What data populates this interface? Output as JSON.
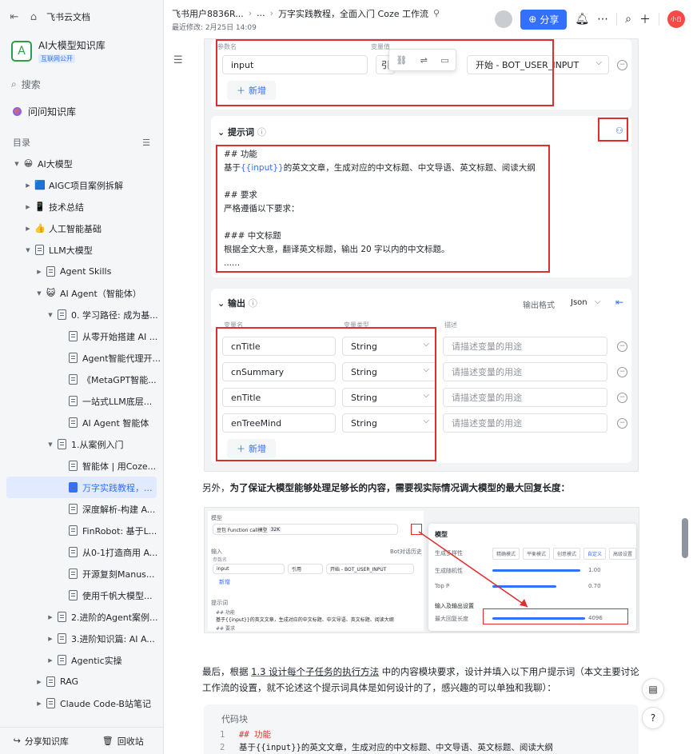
{
  "sidebar": {
    "top_title": "飞书云文档",
    "kb_name": "AI大模型知识库",
    "kb_badge": "互联网公开",
    "search": "搜索",
    "ask": "问问知识库",
    "toc": "目录",
    "tree": [
      {
        "label": "AI大模型",
        "indent": 0,
        "arrow": "▼",
        "icon": "emoji",
        "emoji": "😀"
      },
      {
        "label": "AIGC项目案例拆解",
        "indent": 1,
        "arrow": "▶",
        "icon": "emoji",
        "emoji": "🟦"
      },
      {
        "label": "技术总结",
        "indent": 1,
        "arrow": "▶",
        "icon": "emoji",
        "emoji": "📱"
      },
      {
        "label": "人工智能基础",
        "indent": 1,
        "arrow": "▶",
        "icon": "emoji",
        "emoji": "👍"
      },
      {
        "label": "LLM大模型",
        "indent": 1,
        "arrow": "▼",
        "icon": "doc"
      },
      {
        "label": "Agent Skills",
        "indent": 2,
        "arrow": "▶",
        "icon": "doc"
      },
      {
        "label": "AI Agent（智能体）",
        "indent": 2,
        "arrow": "▼",
        "icon": "emoji",
        "emoji": "😺"
      },
      {
        "label": "0. 学习路径: 成为基...",
        "indent": 3,
        "arrow": "▼",
        "icon": "doc"
      },
      {
        "label": "从零开始搭建 AI ...",
        "indent": 4,
        "arrow": "",
        "icon": "doc"
      },
      {
        "label": "Agent智能代理开...",
        "indent": 4,
        "arrow": "",
        "icon": "doc"
      },
      {
        "label": "《MetaGPT智能...",
        "indent": 4,
        "arrow": "",
        "icon": "doc"
      },
      {
        "label": "一站式LLM底层...",
        "indent": 4,
        "arrow": "",
        "icon": "doc"
      },
      {
        "label": "AI Agent 智能体",
        "indent": 4,
        "arrow": "",
        "icon": "doc"
      },
      {
        "label": "1.从案例入门",
        "indent": 3,
        "arrow": "▼",
        "icon": "doc"
      },
      {
        "label": "智能体 | 用Coze...",
        "indent": 4,
        "arrow": "",
        "icon": "doc"
      },
      {
        "label": "万字实践教程，...",
        "indent": 4,
        "arrow": "",
        "icon": "doc",
        "active": true
      },
      {
        "label": "深度解析-构建 A...",
        "indent": 4,
        "arrow": "",
        "icon": "doc"
      },
      {
        "label": "FinRobot: 基于L...",
        "indent": 4,
        "arrow": "",
        "icon": "doc"
      },
      {
        "label": "从0-1打造商用 A...",
        "indent": 4,
        "arrow": "",
        "icon": "doc"
      },
      {
        "label": "开源复刻Manus...",
        "indent": 4,
        "arrow": "",
        "icon": "doc"
      },
      {
        "label": "使用千帆大模型...",
        "indent": 4,
        "arrow": "",
        "icon": "doc"
      },
      {
        "label": "2.进阶的Agent案例...",
        "indent": 3,
        "arrow": "▶",
        "icon": "doc"
      },
      {
        "label": "3.进阶知识篇: AI A...",
        "indent": 3,
        "arrow": "▶",
        "icon": "doc"
      },
      {
        "label": "Agentic实操",
        "indent": 3,
        "arrow": "▶",
        "icon": "doc"
      },
      {
        "label": "RAG",
        "indent": 2,
        "arrow": "▶",
        "icon": "doc"
      },
      {
        "label": "Claude Code-B站笔记",
        "indent": 2,
        "arrow": "▶",
        "icon": "doc"
      }
    ],
    "share_kb": "分享知识库",
    "recycle": "回收站"
  },
  "header": {
    "crumb_owner": "飞书用户8836R...",
    "crumb_ellipsis": "...",
    "crumb_title": "万字实践教程，全面入门 Coze 工作流",
    "last_modified": "最近修改: 2月25日 14:09",
    "share": "分享",
    "avatar_text": "小白"
  },
  "shot1": {
    "param_name_h": "参数名",
    "var_value_h": "变量值",
    "input_name": "input",
    "input_ref": "引",
    "input_value": "开始 - BOT_USER_INPUT",
    "add": "新增",
    "prompt_title": "提示词",
    "prompt_lines": [
      "## 功能",
      "基于{{input}}的英文文章，生成对应的中文标题、中文导语、英文标题、阅读大纲",
      "",
      "## 要求",
      "严格遵循以下要求：",
      "",
      "### 中文标题",
      "根据全文大意，翻译英文标题，输出 20 字以内的中文标题。",
      "......"
    ],
    "output_title": "输出",
    "output_format_label": "输出格式",
    "output_format": "Json",
    "col_var": "变量名",
    "col_type": "变量类型",
    "col_desc": "描述",
    "outputs": [
      {
        "name": "cnTitle",
        "type": "String",
        "desc": "请描述变量的用途"
      },
      {
        "name": "cnSummary",
        "type": "String",
        "desc": "请描述变量的用途"
      },
      {
        "name": "enTitle",
        "type": "String",
        "desc": "请描述变量的用途"
      },
      {
        "name": "enTreeMind",
        "type": "String",
        "desc": "请描述变量的用途"
      }
    ]
  },
  "para1": {
    "plain": "另外，",
    "bold": "为了保证大模型能够处理足够长的内容，需要视实际情况调大模型的最大回复长度："
  },
  "shot2": {
    "model_label": "模型",
    "model_value": "豆包 Function call模型",
    "model_tag": "32K",
    "input_label": "输入",
    "bot_history": "Bot对话历史",
    "param_name": "参数名",
    "input_name": "input",
    "ref": "引用",
    "value": "开始 - BOT_USER_INPUT",
    "add": "新增",
    "prompt_label": "提示词",
    "prompt_l1": "## 功能",
    "prompt_l2": "基于{{input}}的英文文章，生成对应的中文标题、中文导语、英文标题、阅读大纲",
    "prompt_l3": "## 要求",
    "panel_title": "模型",
    "diversity": "生成多样性",
    "modes": [
      "精确模式",
      "平衡模式",
      "创意模式",
      "自定义",
      "高级设置"
    ],
    "temperature_label": "生成随机性",
    "temperature": "1.00",
    "top_p_label": "Top P",
    "top_p": "0.70",
    "io_settings": "输入及输出设置",
    "max_len_label": "最大回复长度",
    "max_len": "4096"
  },
  "para2": {
    "before": "最后，根据 ",
    "link": "1.3 设计每个子任务的执行方法",
    "after": " 中的内容模块要求，设计并填入以下用户提示词（本文主要讨论工作流的设置，就不论述这个提示词具体是如何设计的了，感兴趣的可以单独和我聊）："
  },
  "code": {
    "header": "代码块",
    "lines": [
      {
        "n": "1",
        "t": "## 功能",
        "red": true
      },
      {
        "n": "2",
        "t": "基于{{input}}的英文文章，生成对应的中文标题、中文导语、英文标题、阅读大纲",
        "red": false
      }
    ]
  }
}
